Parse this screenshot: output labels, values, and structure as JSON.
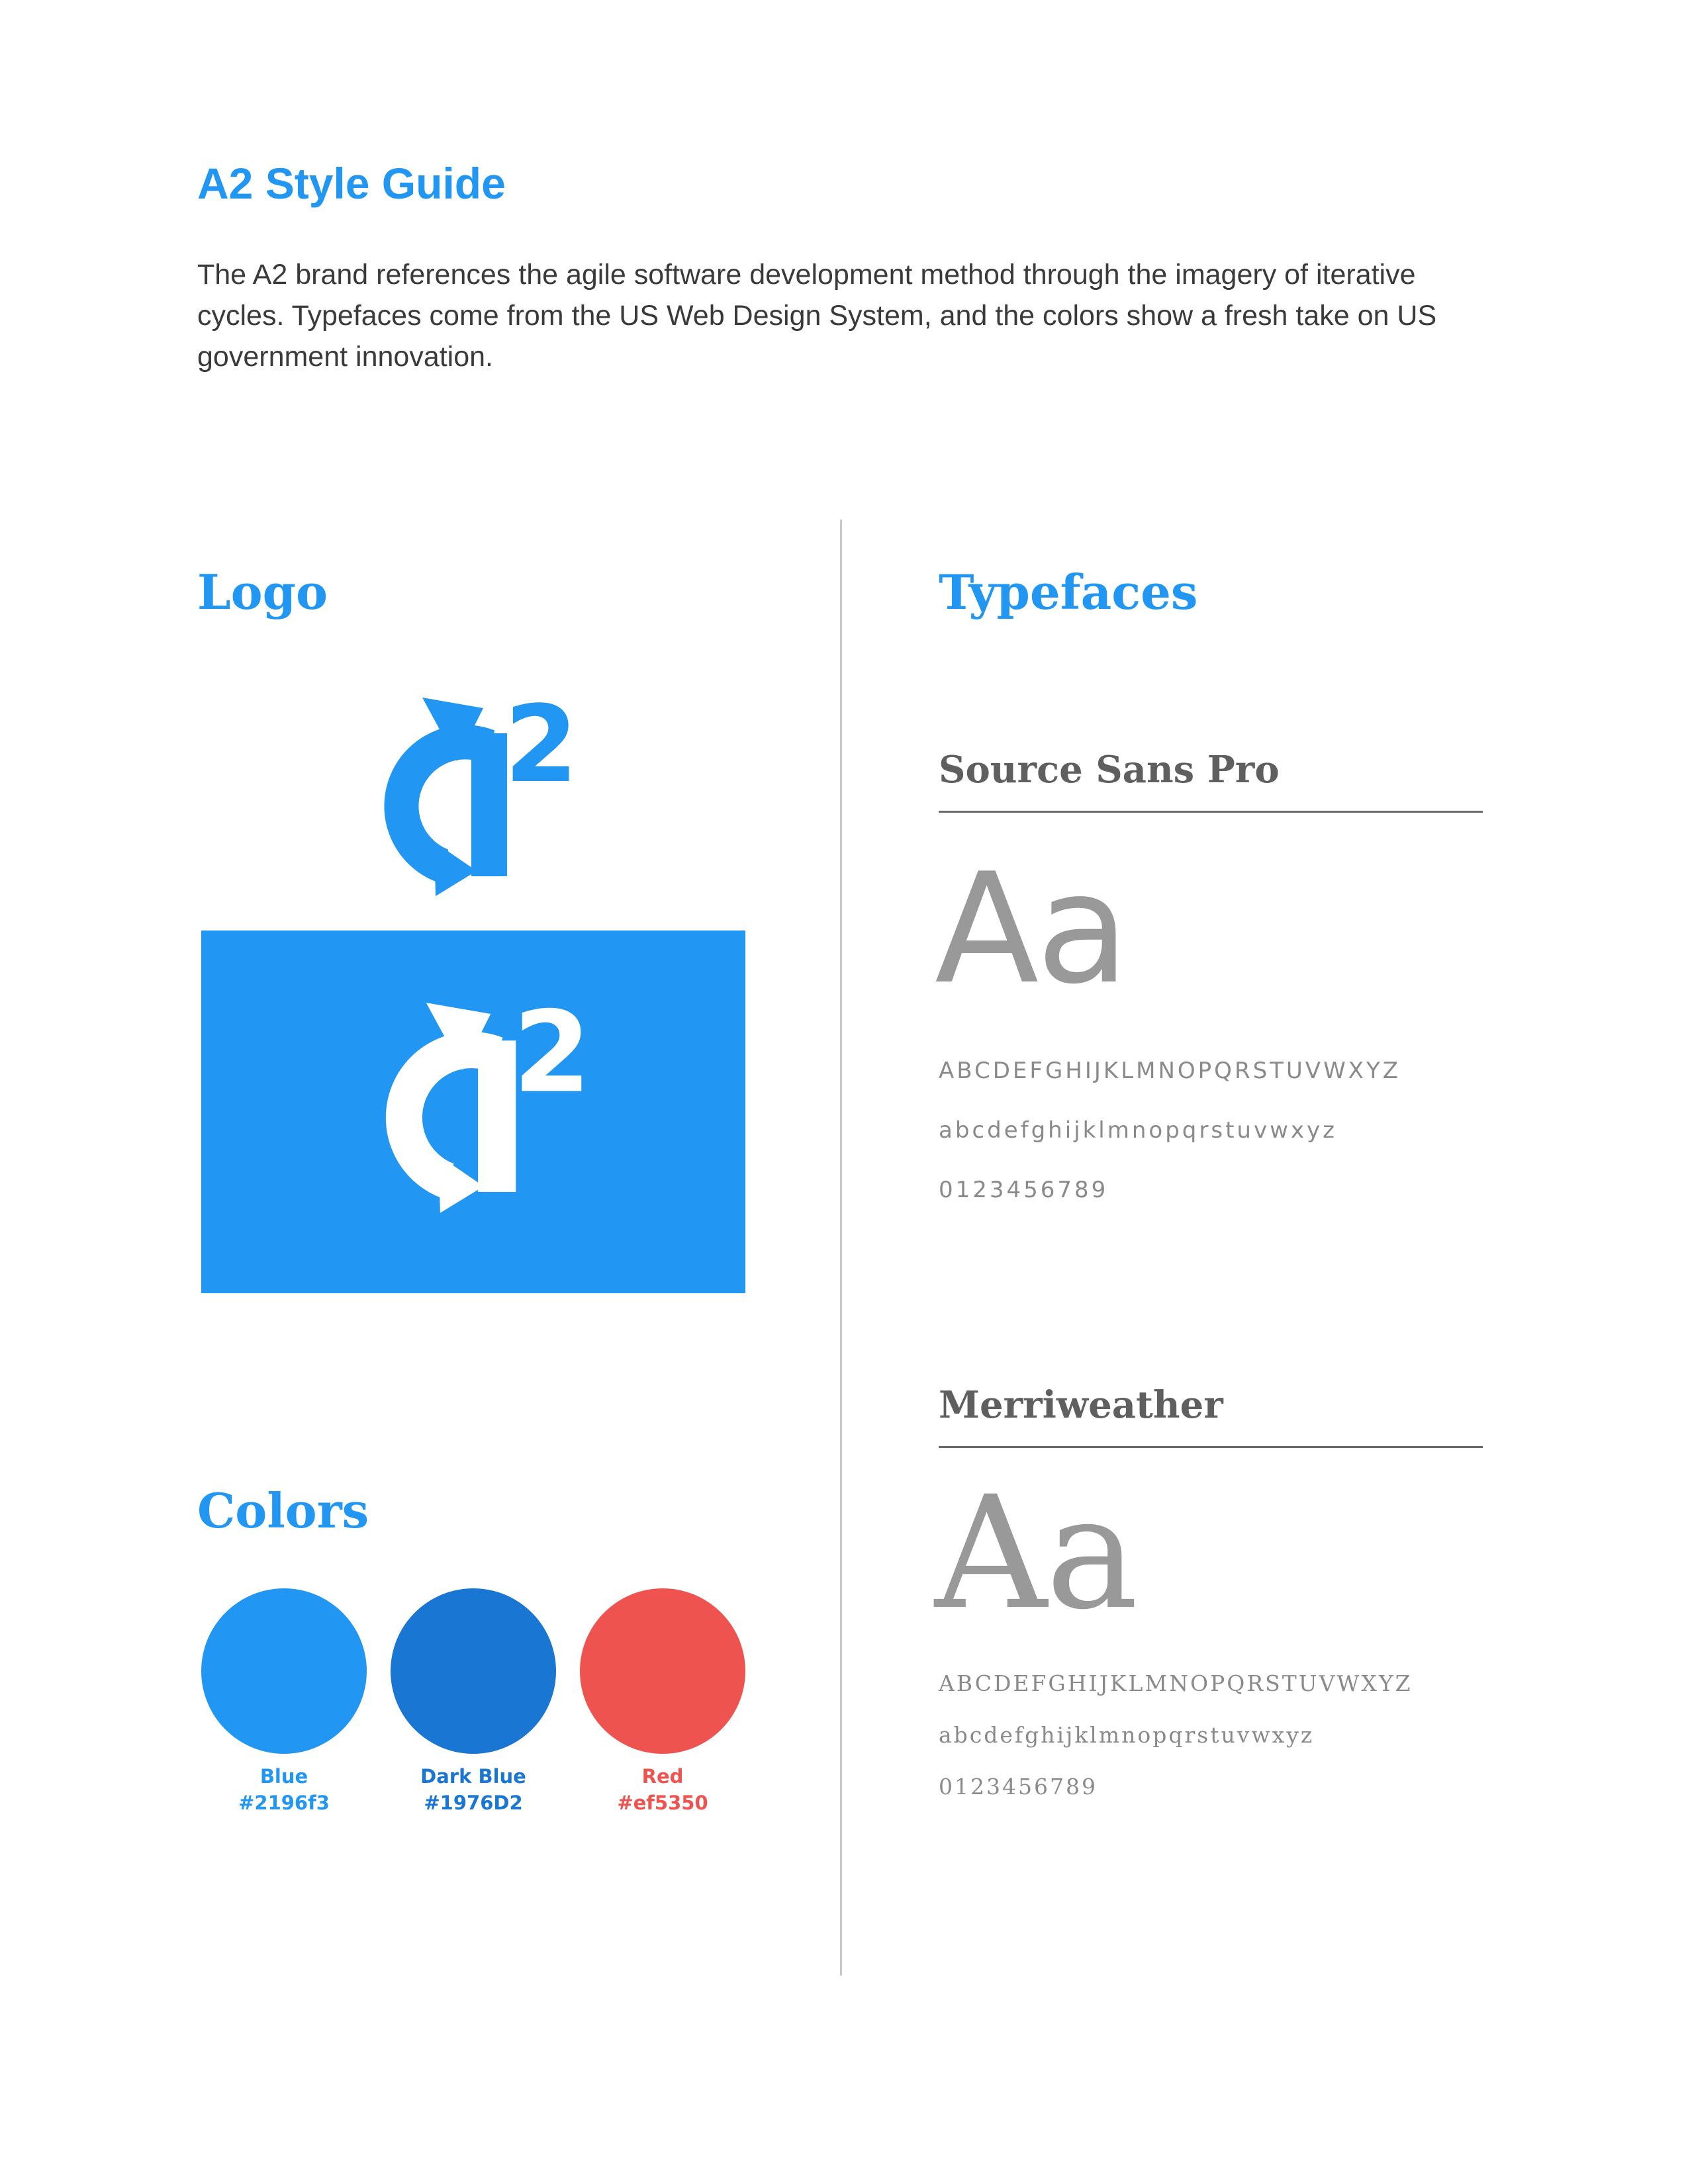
{
  "header": {
    "title": "A2 Style Guide",
    "intro": "The A2 brand references the agile software development method through the imagery of iterative cycles. Typefaces come from the US Web Design System, and the colors show a fresh take on US government innovation."
  },
  "logo_section": {
    "title": "Logo",
    "logo_icon": "a2-cycle-logo"
  },
  "colors_section": {
    "title": "Colors",
    "swatches": [
      {
        "name": "Blue",
        "hex": "#2196f3",
        "label_color": "#2196f3"
      },
      {
        "name": "Dark Blue",
        "hex": "#1976D2",
        "label_color": "#1976d2"
      },
      {
        "name": "Red",
        "hex": "#ef5350",
        "label_color": "#ef5350"
      }
    ]
  },
  "typefaces_section": {
    "title": "Typefaces",
    "fonts": [
      {
        "name": "Source Sans Pro",
        "sample": "Aa",
        "uppercase": "ABCDEFGHIJKLMNOPQRSTUVWXYZ",
        "lowercase": "abcdefghijklmnopqrstuvwxyz",
        "digits": "0123456789"
      },
      {
        "name": "Merriweather",
        "sample": "Aa",
        "uppercase": "ABCDEFGHIJKLMNOPQRSTUVWXYZ",
        "lowercase": "abcdefghijklmnopqrstuvwxyz",
        "digits": "0123456789"
      }
    ]
  }
}
